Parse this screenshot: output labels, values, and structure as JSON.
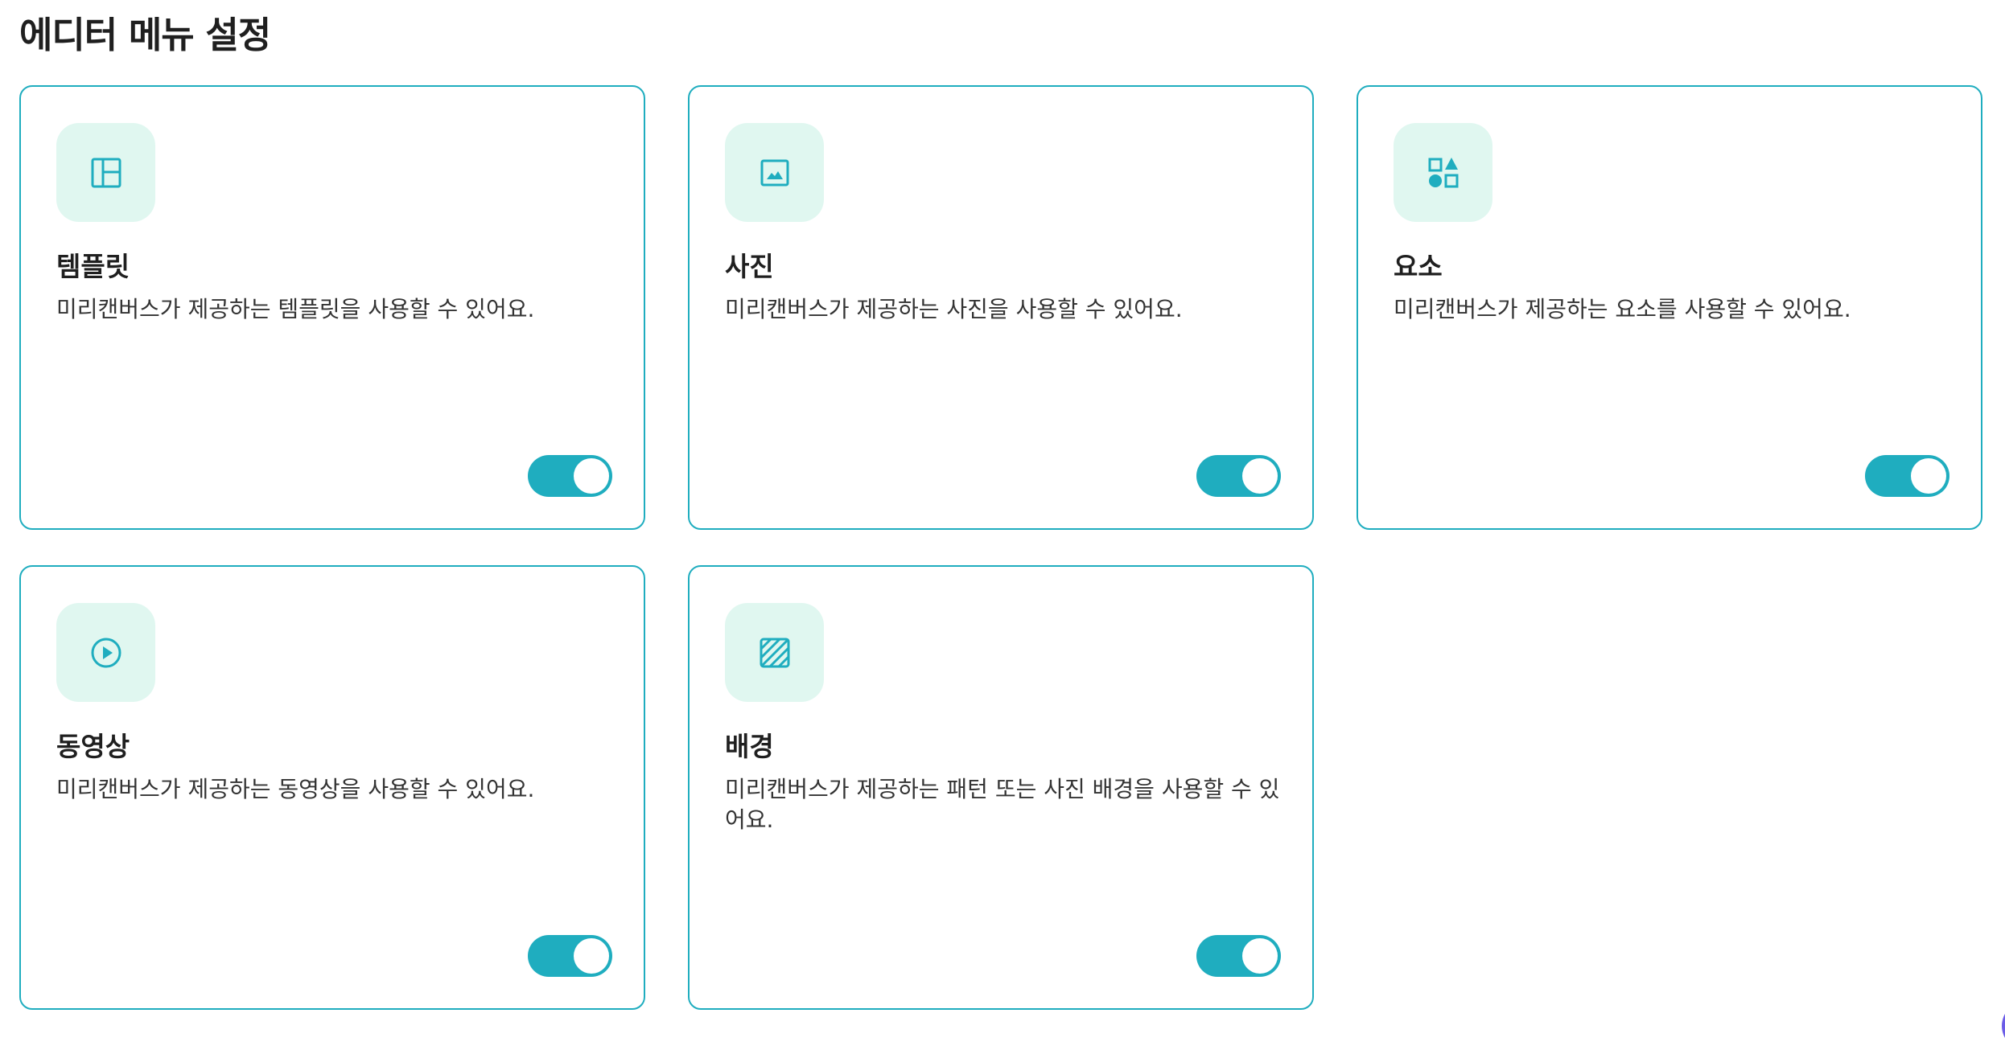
{
  "page": {
    "title": "에디터 메뉴 설정"
  },
  "cards": [
    {
      "title": "템플릿",
      "description": "미리캔버스가 제공하는 템플릿을 사용할 수 있어요.",
      "icon": "layout-template-icon",
      "enabled": true
    },
    {
      "title": "사진",
      "description": "미리캔버스가 제공하는 사진을 사용할 수 있어요.",
      "icon": "image-icon",
      "enabled": true
    },
    {
      "title": "요소",
      "description": "미리캔버스가 제공하는 요소를 사용할 수 있어요.",
      "icon": "shapes-icon",
      "enabled": true
    },
    {
      "title": "동영상",
      "description": "미리캔버스가 제공하는 동영상을 사용할 수 있어요.",
      "icon": "play-circle-icon",
      "enabled": true
    },
    {
      "title": "배경",
      "description": "미리캔버스가 제공하는 패턴 또는 사진 배경을 사용할 수 있어요.",
      "icon": "pattern-background-icon",
      "enabled": true
    }
  ],
  "colors": {
    "accent": "#1fadbf",
    "icon_background": "#e0f7f0",
    "text": "#1f1f1f"
  }
}
